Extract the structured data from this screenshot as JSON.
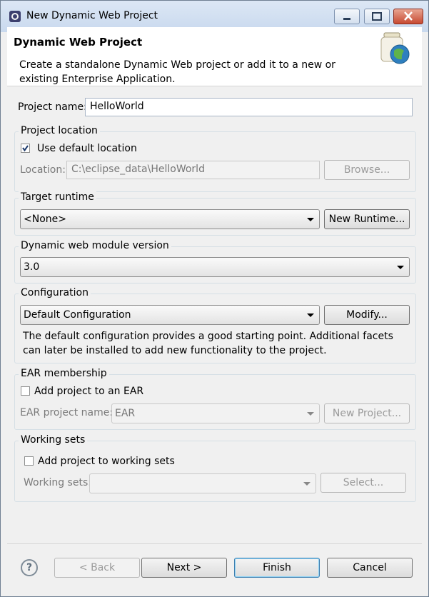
{
  "window": {
    "title": "New Dynamic Web Project"
  },
  "banner": {
    "title": "Dynamic Web Project",
    "description": "Create a standalone Dynamic Web project or add it to a new or existing Enterprise Application."
  },
  "project_name": {
    "label": "Project name:",
    "value": "HelloWorld"
  },
  "project_location": {
    "group_title": "Project location",
    "use_default_label": "Use default location",
    "use_default_checked": true,
    "location_label": "Location:",
    "location_value": "C:\\eclipse_data\\HelloWorld",
    "browse_label": "Browse..."
  },
  "target_runtime": {
    "group_title": "Target runtime",
    "selected": "<None>",
    "new_runtime_label": "New Runtime..."
  },
  "module_version": {
    "group_title": "Dynamic web module version",
    "selected": "3.0"
  },
  "configuration": {
    "group_title": "Configuration",
    "selected": "Default Configuration",
    "modify_label": "Modify...",
    "description": "The default configuration provides a good starting point. Additional facets can later be installed to add new functionality to the project."
  },
  "ear": {
    "group_title": "EAR membership",
    "add_label": "Add project to an EAR",
    "add_checked": false,
    "project_name_label": "EAR project name:",
    "project_name_value": "EAR",
    "new_project_label": "New Project..."
  },
  "working_sets": {
    "group_title": "Working sets",
    "add_label": "Add project to working sets",
    "add_checked": false,
    "sets_label": "Working sets:",
    "sets_value": "",
    "select_label": "Select..."
  },
  "footer": {
    "help_glyph": "?",
    "back_label": "< Back",
    "next_label": "Next >",
    "finish_label": "Finish",
    "cancel_label": "Cancel"
  }
}
